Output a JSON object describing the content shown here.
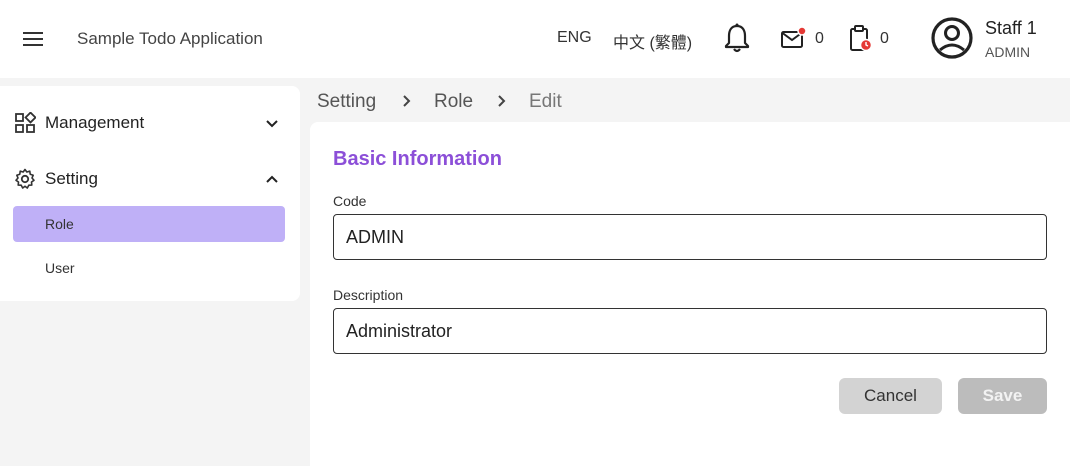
{
  "header": {
    "app_title": "Sample Todo Application",
    "languages": [
      "ENG",
      "中文 (繁體)"
    ],
    "mail_count": "0",
    "task_count": "0",
    "user_name": "Staff 1",
    "user_role": "ADMIN",
    "icons": [
      "menu-icon",
      "bell-icon",
      "mail-icon",
      "clipboard-icon",
      "account-circle-icon"
    ]
  },
  "sidebar": {
    "groups": [
      {
        "label": "Management",
        "icon": "dashboard-icon",
        "expanded": false
      },
      {
        "label": "Setting",
        "icon": "gear-icon",
        "expanded": true,
        "items": [
          {
            "label": "Role",
            "active": true
          },
          {
            "label": "User",
            "active": false
          }
        ]
      }
    ]
  },
  "breadcrumb": [
    "Setting",
    "Role",
    "Edit"
  ],
  "form": {
    "section_title": "Basic Information",
    "fields": [
      {
        "label": "Code",
        "value": "ADMIN"
      },
      {
        "label": "Description",
        "value": "Administrator"
      }
    ],
    "cancel_label": "Cancel",
    "save_label": "Save"
  },
  "colors": {
    "accent": "#8c4fd8",
    "active_nav_bg": "#bfb0f7",
    "notification_dot": "#e53935"
  }
}
